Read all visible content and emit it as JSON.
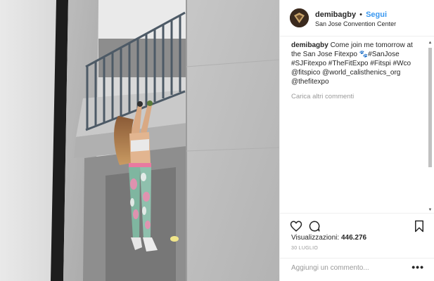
{
  "post": {
    "username": "demibagby",
    "separator": "•",
    "follow_label": "Segui",
    "location": "San Jose Convention Center",
    "caption_user": "demibagby",
    "caption_text": " Come join me tomorrow at the San Jose Fitexpo 🐾#SanJose #SJFitexpo #TheFitExpo #Fitspi #Wco @fitspico @world_calisthenics_org @thefitexpo",
    "load_more": "Carica altri commenti",
    "views_label": "Visualizzazioni:",
    "views_count": "446.276",
    "date": "30 LUGLIO",
    "comment_placeholder": "Aggiungi un commento...",
    "more_options": "•••"
  },
  "icons": {
    "like": "heart-icon",
    "comment": "comment-icon",
    "save": "bookmark-icon",
    "avatar": "profile-picture",
    "scroll_up": "scroll-up-arrow-icon",
    "scroll_down": "scroll-down-arrow-icon"
  },
  "colors": {
    "link_blue": "#3897f0",
    "muted_gray": "#999999",
    "text": "#262626",
    "border": "#efefef"
  }
}
